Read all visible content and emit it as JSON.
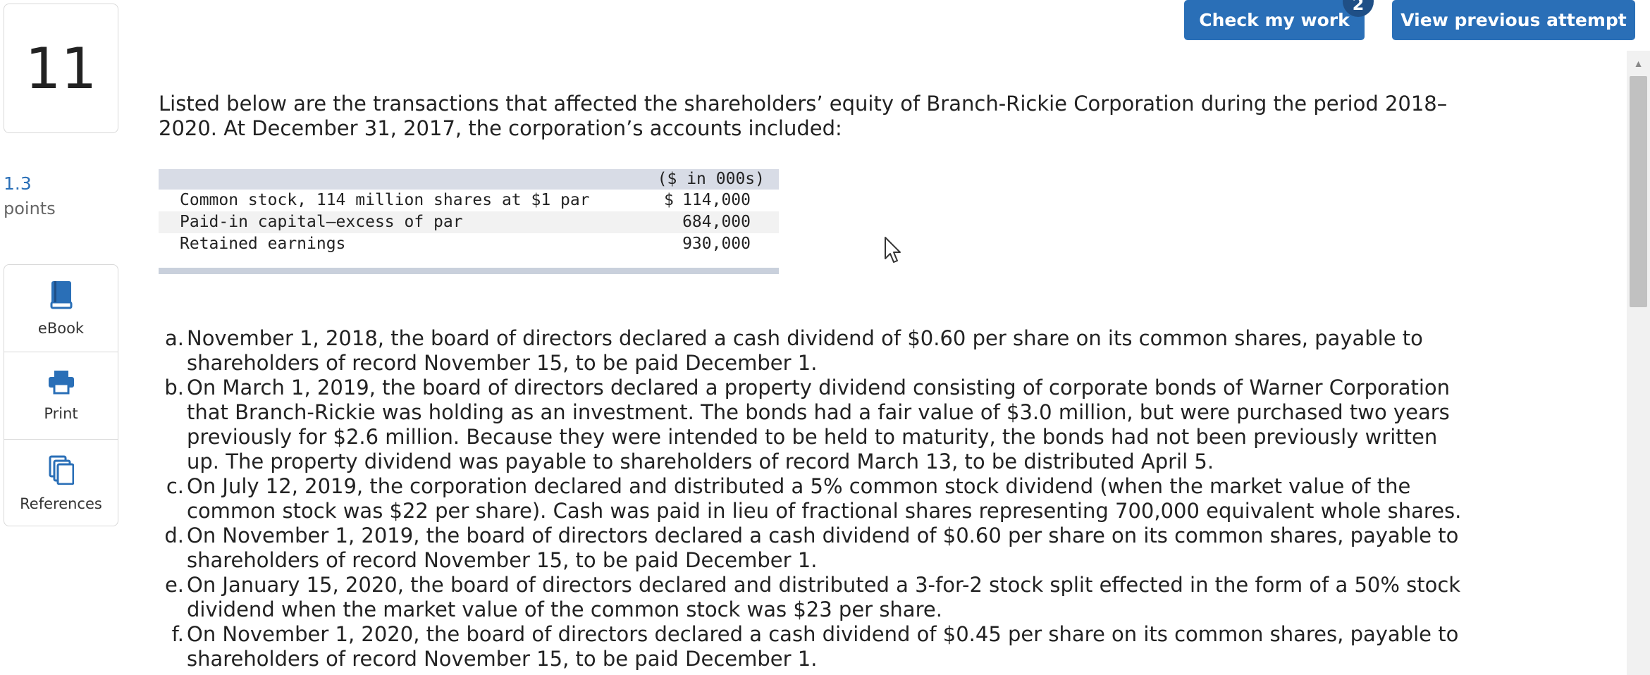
{
  "header": {
    "check_label": "Check my work",
    "attempt_badge": "2",
    "view_label": "View previous attempt"
  },
  "question": {
    "number": "11",
    "points_value": "1.3",
    "points_label": "points"
  },
  "tools": [
    {
      "label": "eBook",
      "icon": "book-icon"
    },
    {
      "label": "Print",
      "icon": "printer-icon"
    },
    {
      "label": "References",
      "icon": "copy-icon"
    }
  ],
  "intro_text": "Listed below are the transactions that affected the shareholders’ equity of Branch-Rickie Corporation during the period 2018–2020. At December 31, 2017, the corporation’s accounts included:",
  "accounts_table": {
    "header": "($ in 000s)",
    "rows": [
      {
        "label": "Common stock, 114 million shares at $1 par",
        "dollar": "$",
        "value": "114,000"
      },
      {
        "label": "Paid-in capital—excess of par",
        "dollar": "",
        "value": "684,000"
      },
      {
        "label": "Retained earnings",
        "dollar": "",
        "value": "930,000"
      }
    ]
  },
  "transactions": [
    {
      "letter": "a.",
      "text": "November 1, 2018, the board of directors declared a cash dividend of $0.60 per share on its common shares, payable to shareholders of record November 15, to be paid December 1."
    },
    {
      "letter": "b.",
      "text": "On March 1, 2019, the board of directors declared a property dividend consisting of corporate bonds of Warner Corporation that Branch-Rickie was holding as an investment. The bonds had a fair value of $3.0 million, but were purchased two years previously for $2.6 million. Because they were intended to be held to maturity, the bonds had not been previously written up. The property dividend was payable to shareholders of record March 13, to be distributed April 5."
    },
    {
      "letter": "c.",
      "text": "On July 12, 2019, the corporation declared and distributed a 5% common stock dividend (when the market value of the common stock was $22 per share). Cash was paid in lieu of fractional shares representing 700,000 equivalent whole shares."
    },
    {
      "letter": "d.",
      "text": "On November 1, 2019, the board of directors declared a cash dividend of $0.60 per share on its common shares, payable to shareholders of record November 15, to be paid December 1."
    },
    {
      "letter": "e.",
      "text": "On January 15, 2020, the board of directors declared and distributed a 3-for-2 stock split effected in the form of a 50% stock dividend when the market value of the common stock was $23 per share."
    },
    {
      "letter": "f.",
      "text": "On November 1, 2020, the board of directors declared a cash dividend of $0.45 per share on its common shares, payable to shareholders of record November 15, to be paid December 1."
    }
  ],
  "colors": {
    "accent": "#2a6fb7",
    "badge": "#1f4f86",
    "table_header": "#d8dce6"
  }
}
